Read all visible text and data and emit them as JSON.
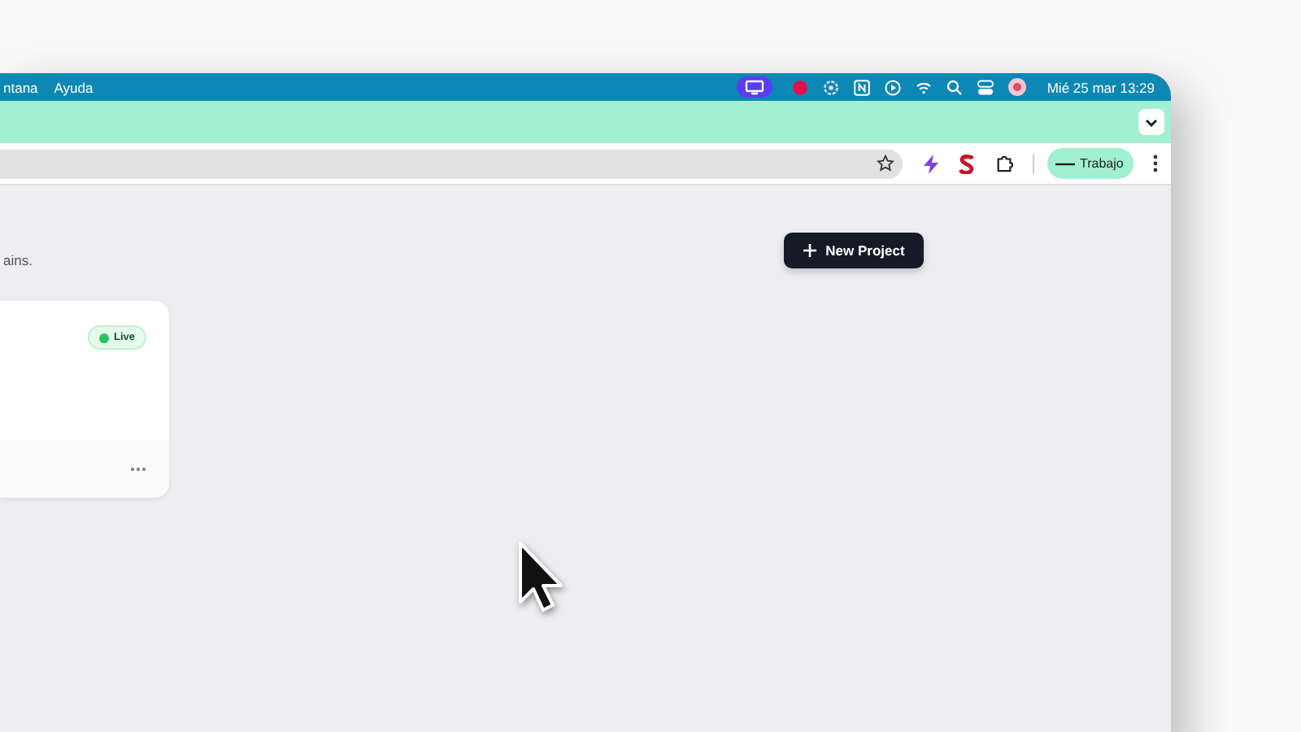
{
  "menu_bar": {
    "menus": [
      "ntana",
      "Ayuda"
    ],
    "clock": "Mié 25 mar 13:29"
  },
  "toolbar": {
    "profile": "Trabajo"
  },
  "page": {
    "subtitle": "ains.",
    "new_project_button": "New Project",
    "project_card": {
      "status": "Live"
    }
  }
}
